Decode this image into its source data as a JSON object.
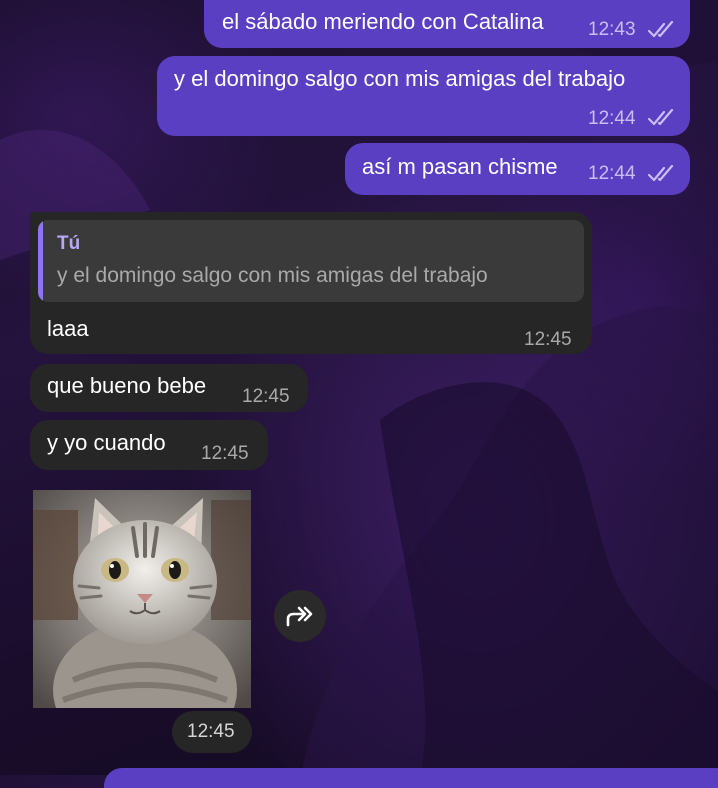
{
  "chat": {
    "outgoing": [
      {
        "text": "el sábado meriendo con Catalina",
        "time": "12:43",
        "status_icon": "double-check-icon"
      },
      {
        "text": "y el domingo salgo con mis amigas del trabajo",
        "time": "12:44",
        "status_icon": "double-check-icon"
      },
      {
        "text": "así m pasan chisme",
        "time": "12:44",
        "status_icon": "double-check-icon"
      }
    ],
    "incoming": [
      {
        "reply": {
          "author": "Tú",
          "text": "y el domingo salgo con mis amigas del trabajo"
        },
        "text": "laaa",
        "time": "12:45"
      },
      {
        "text": "que bueno bebe",
        "time": "12:45"
      },
      {
        "text": "y yo cuando",
        "time": "12:45"
      }
    ],
    "sticker": {
      "subject": "cat-sticker",
      "time": "12:45",
      "action_icon": "forward-icon"
    }
  },
  "colors": {
    "outgoing_bubble": "#5b3fc2",
    "incoming_bubble": "#262626",
    "reply_accent": "#8e75f0",
    "background": "#1b0f2e"
  }
}
